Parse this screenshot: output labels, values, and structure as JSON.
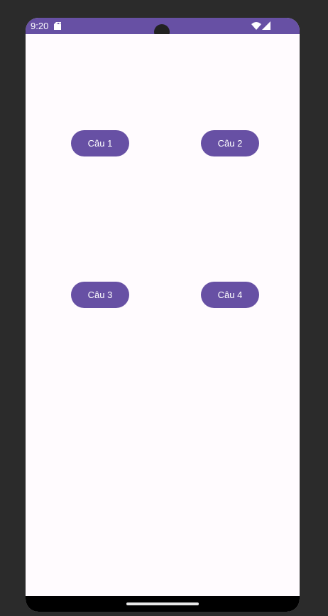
{
  "status_bar": {
    "time": "9:20",
    "icons": [
      "sd-card-icon",
      "wifi-icon",
      "cellular-signal-icon"
    ]
  },
  "buttons": [
    {
      "label": "Câu 1"
    },
    {
      "label": "Câu 2"
    },
    {
      "label": "Câu 3"
    },
    {
      "label": "Câu 4"
    }
  ],
  "colors": {
    "primary": "#6750a4",
    "on_primary": "#ffffff",
    "background": "#fffbfe",
    "frame": "#2b2b2b",
    "nav_bar": "#000000"
  }
}
